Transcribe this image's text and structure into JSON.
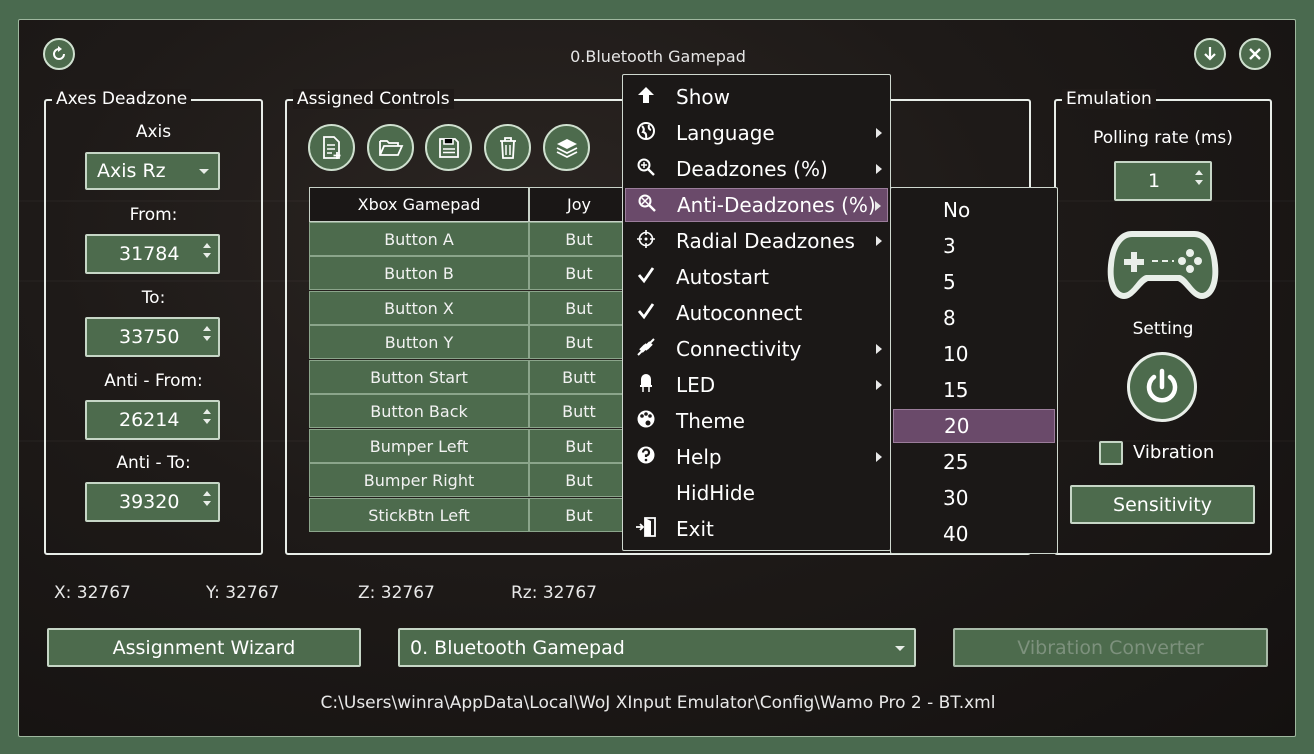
{
  "window": {
    "title": "0.Bluetooth Gamepad",
    "refresh_icon": "refresh-icon",
    "minimize_icon": "download-arrow-icon",
    "close_icon": "close-icon"
  },
  "axes_deadzone": {
    "group_title": "Axes Deadzone",
    "axis_label": "Axis",
    "axis_value": "Axis Rz",
    "from_label": "From:",
    "from_value": "31784",
    "to_label": "To:",
    "to_value": "33750",
    "anti_from_label": "Anti - From:",
    "anti_from_value": "26214",
    "anti_to_label": "Anti - To:",
    "anti_to_value": "39320"
  },
  "assigned_controls": {
    "group_title": "Assigned Controls",
    "toolbar": [
      "new-document-icon",
      "open-folder-icon",
      "save-icon",
      "trash-icon",
      "layers-icon"
    ],
    "columns": [
      "Xbox Gamepad",
      "Joy"
    ],
    "rows": [
      {
        "xbox": "Button A",
        "joy": "But"
      },
      {
        "xbox": "Button B",
        "joy": "But"
      },
      {
        "xbox": "Button X",
        "joy": "But"
      },
      {
        "xbox": "Button Y",
        "joy": "But"
      },
      {
        "xbox": "Button Start",
        "joy": "Butt"
      },
      {
        "xbox": "Button Back",
        "joy": "Butt"
      },
      {
        "xbox": "Bumper Left",
        "joy": "But"
      },
      {
        "xbox": "Bumper Right",
        "joy": "But"
      },
      {
        "xbox": "StickBtn Left",
        "joy": "But"
      }
    ]
  },
  "emulation": {
    "group_title": "Emulation",
    "polling_label": "Polling rate (ms)",
    "polling_value": "1",
    "gamepad_icon": "gamepad-icon",
    "setting_label": "Setting",
    "power_icon": "power-icon",
    "vibration_label": "Vibration",
    "vibration_checked": false,
    "sensitivity_label": "Sensitivity"
  },
  "status": {
    "x": "X: 32767",
    "y": "Y: 32767",
    "z": "Z: 32767",
    "rz": "Rz: 32767"
  },
  "bottom": {
    "wizard_label": "Assignment Wizard",
    "device_value": "0. Bluetooth Gamepad",
    "vibration_converter_label": "Vibration Converter",
    "config_path": "C:\\Users\\winra\\AppData\\Local\\WoJ XInput Emulator\\Config\\Wamo Pro 2 - BT.xml"
  },
  "context_menu": {
    "items": [
      {
        "label": "Show",
        "icon": "up-arrow-icon",
        "submenu": false
      },
      {
        "label": "Language",
        "icon": "globe-icon",
        "submenu": true
      },
      {
        "label": "Deadzones (%)",
        "icon": "deadzone-icon",
        "submenu": true
      },
      {
        "label": "Anti-Deadzones (%)",
        "icon": "anti-deadzone-icon",
        "submenu": true,
        "highlighted": true
      },
      {
        "label": "Radial Deadzones",
        "icon": "crosshair-icon",
        "submenu": true
      },
      {
        "label": "Autostart",
        "icon": "check-icon",
        "submenu": false
      },
      {
        "label": "Autoconnect",
        "icon": "check-icon",
        "submenu": false
      },
      {
        "label": "Connectivity",
        "icon": "plug-icon",
        "submenu": true
      },
      {
        "label": "LED",
        "icon": "led-icon",
        "submenu": true
      },
      {
        "label": "Theme",
        "icon": "palette-icon",
        "submenu": false
      },
      {
        "label": "Help",
        "icon": "question-icon",
        "submenu": true
      },
      {
        "label": "HidHide",
        "icon": "",
        "submenu": false
      },
      {
        "label": "Exit",
        "icon": "exit-door-icon",
        "submenu": false
      }
    ]
  },
  "submenu": {
    "items": [
      "No",
      "3",
      "5",
      "8",
      "10",
      "15",
      "20",
      "25",
      "30",
      "40"
    ],
    "selected": "20"
  },
  "colors": {
    "accent_green": "#4d6b4d",
    "highlight_purple": "#6a4a6a",
    "background": "#1e1a18"
  }
}
